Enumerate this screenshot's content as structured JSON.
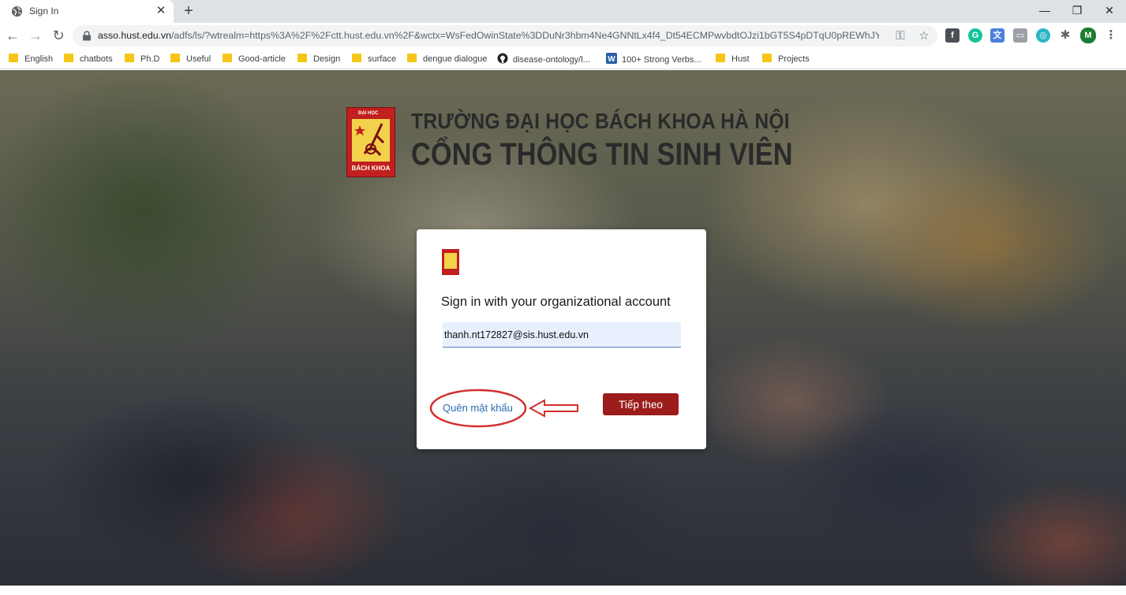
{
  "browser": {
    "tab_title": "Sign In",
    "url_host": "asso.hust.edu.vn",
    "url_path": "/adfs/ls/?wtrealm=https%3A%2F%2Fctt.hust.edu.vn%2F&wctx=WsFedOwinState%3DDuNr3hbm4Ne4GNNtLx4f4_Dt54ECMPwvbdtOJzi1bGT5S4pDTqU0pREWhJY-f...",
    "profile_initial": "M",
    "bookmarks": [
      "English",
      "chatbots",
      "Ph.D",
      "Useful",
      "Good-article",
      "Design",
      "surface",
      "dengue dialogue",
      "disease-ontology/l...",
      "100+ Strong Verbs...",
      "Hust",
      "Projects"
    ]
  },
  "header": {
    "logo_top_text": "ĐẠI HỌC",
    "logo_bottom_text": "BÁCH KHOA",
    "line1": "TRƯỜNG ĐẠI HỌC BÁCH KHOA HÀ NỘI",
    "line2": "CỔNG THÔNG TIN SINH VIÊN"
  },
  "signin": {
    "title": "Sign in with your organizational account",
    "email_value": "thanh.nt172827@sis.hust.edu.vn",
    "forgot_label": "Quên mật khẩu",
    "next_label": "Tiếp theo"
  },
  "colors": {
    "button": "#9c1c1c",
    "link": "#2b6cb0",
    "annotation": "#d32f2f"
  }
}
